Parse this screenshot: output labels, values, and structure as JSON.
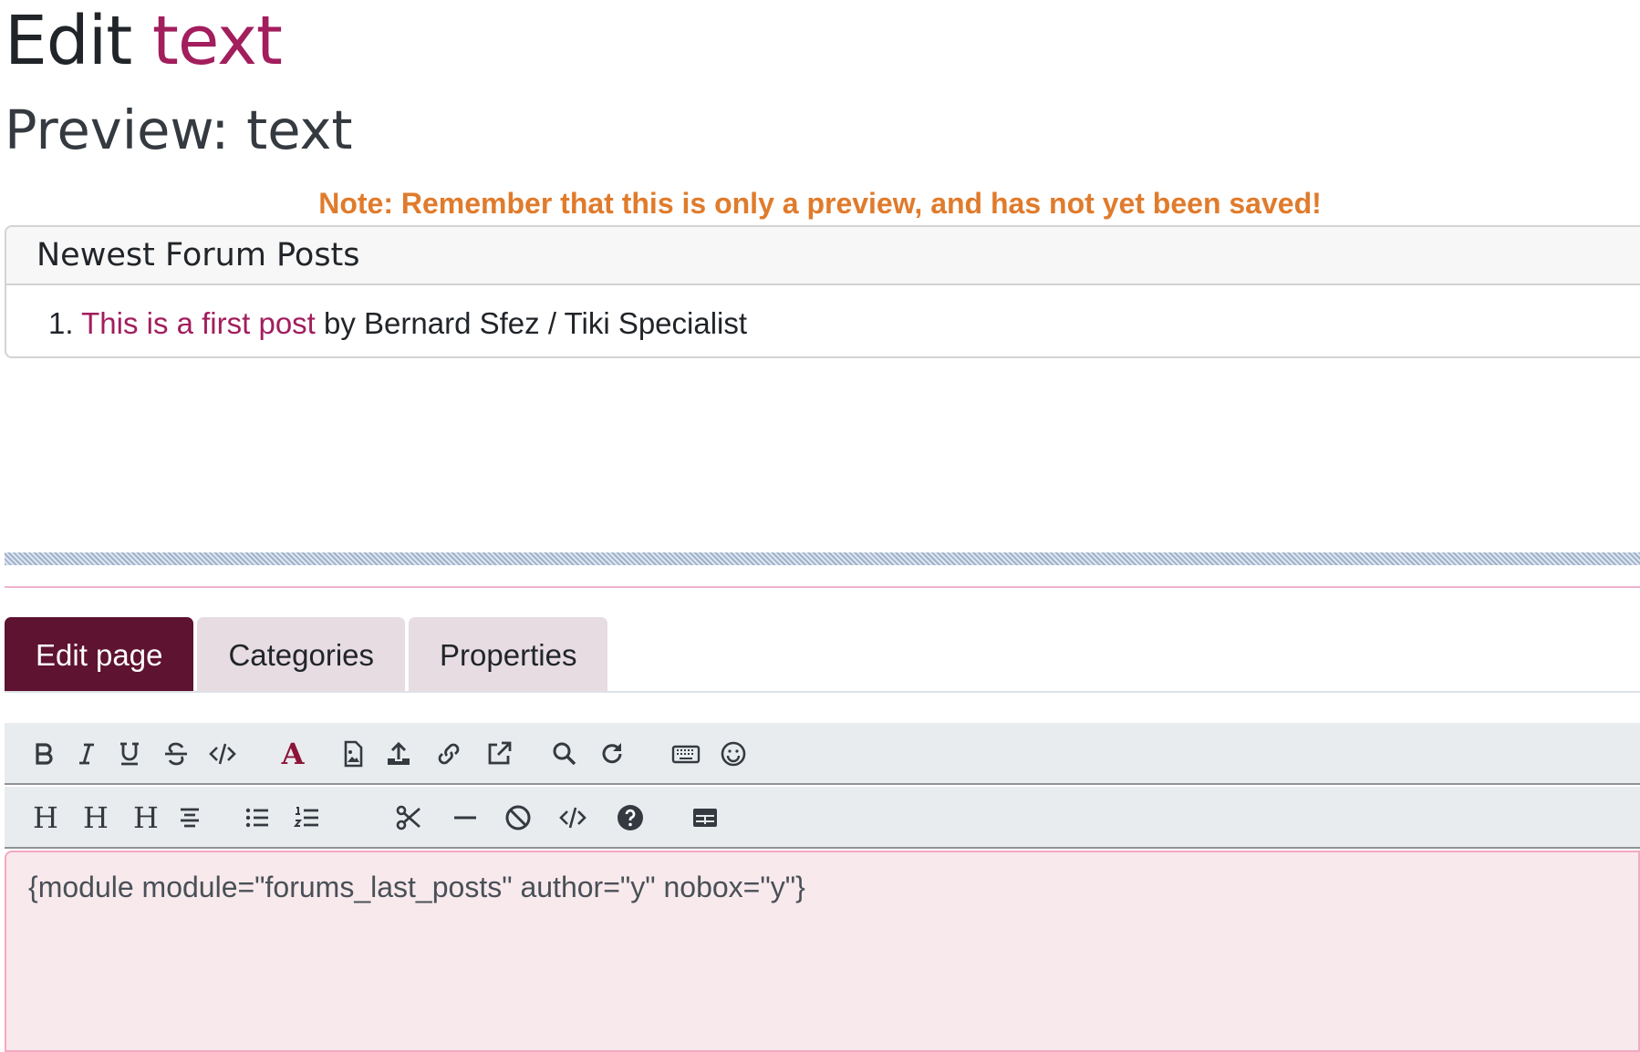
{
  "header": {
    "title_prefix": "Edit",
    "title_page": "text",
    "preview_label": "Preview: text",
    "preview_note": "Note: Remember that this is only a preview, and has not yet been saved!"
  },
  "module": {
    "title": "Newest Forum Posts",
    "posts": [
      {
        "number": "1.",
        "title": "This is a first post",
        "by": "by",
        "author": "Bernard Sfez / Tiki Specialist"
      }
    ]
  },
  "tabs": [
    {
      "label": "Edit page",
      "active": true
    },
    {
      "label": "Categories",
      "active": false
    },
    {
      "label": "Properties",
      "active": false
    }
  ],
  "toolbar": {
    "row1": [
      "bold-icon",
      "italic-icon",
      "underline-icon",
      "strikethrough-icon",
      "code-icon",
      "font-color-icon",
      "image-icon",
      "upload-icon",
      "link-icon",
      "external-link-icon",
      "search-icon",
      "redo-icon",
      "keyboard-icon",
      "smiley-icon"
    ],
    "row2": [
      "heading1-icon",
      "heading2-icon",
      "heading3-icon",
      "align-center-icon",
      "bulleted-list-icon",
      "numbered-list-icon",
      "cut-icon",
      "horizontal-rule-icon",
      "no-parse-icon",
      "code-snippet-icon",
      "help-icon",
      "table-icon"
    ],
    "heading_glyph": "H",
    "font_color_glyph": "A"
  },
  "editor": {
    "content": "{module module=\"forums_last_posts\" author=\"y\" nobox=\"y\"}"
  },
  "colors": {
    "link": "#a21e5d",
    "note": "#e07b2c",
    "active_tab": "#5e1330",
    "inactive_tab": "#e6dce1",
    "editor_bg": "#f8e9ec",
    "toolbar_bg": "#e9ecef"
  }
}
